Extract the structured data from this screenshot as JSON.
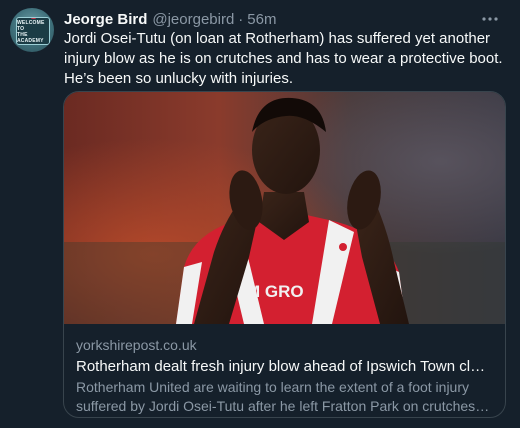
{
  "author": {
    "display_name": "Jeorge Bird",
    "handle": "@jeorgebird",
    "separator": "·",
    "timestamp": "56m",
    "avatar_text_1": "WELCOME TO",
    "avatar_text_2": "THE ACADEMY"
  },
  "tweet": {
    "text": "Jordi Osei-Tutu (on loan at Rotherham) has suffered yet another injury blow as he is on crutches and has to wear a protective boot. He’s been so unlucky with injuries."
  },
  "icons": {
    "more": "more-horizontal-icon"
  },
  "card": {
    "domain": "yorkshirepost.co.uk",
    "title": "Rotherham dealt fresh injury blow ahead of Ipswich Town clash as Ars...",
    "description_line1": "Rotherham United are waiting to learn the extent of a foot injury",
    "description_line2": "suffered by Jordi Osei-Tutu after he left Fratton Park on crutches on ...",
    "image_shirt_text": "M GRO"
  },
  "colors": {
    "background": "#15202b",
    "text_primary": "#f7f9f9",
    "text_secondary": "#8b98a5",
    "border": "#38444d",
    "shirt_red": "#d32030"
  }
}
